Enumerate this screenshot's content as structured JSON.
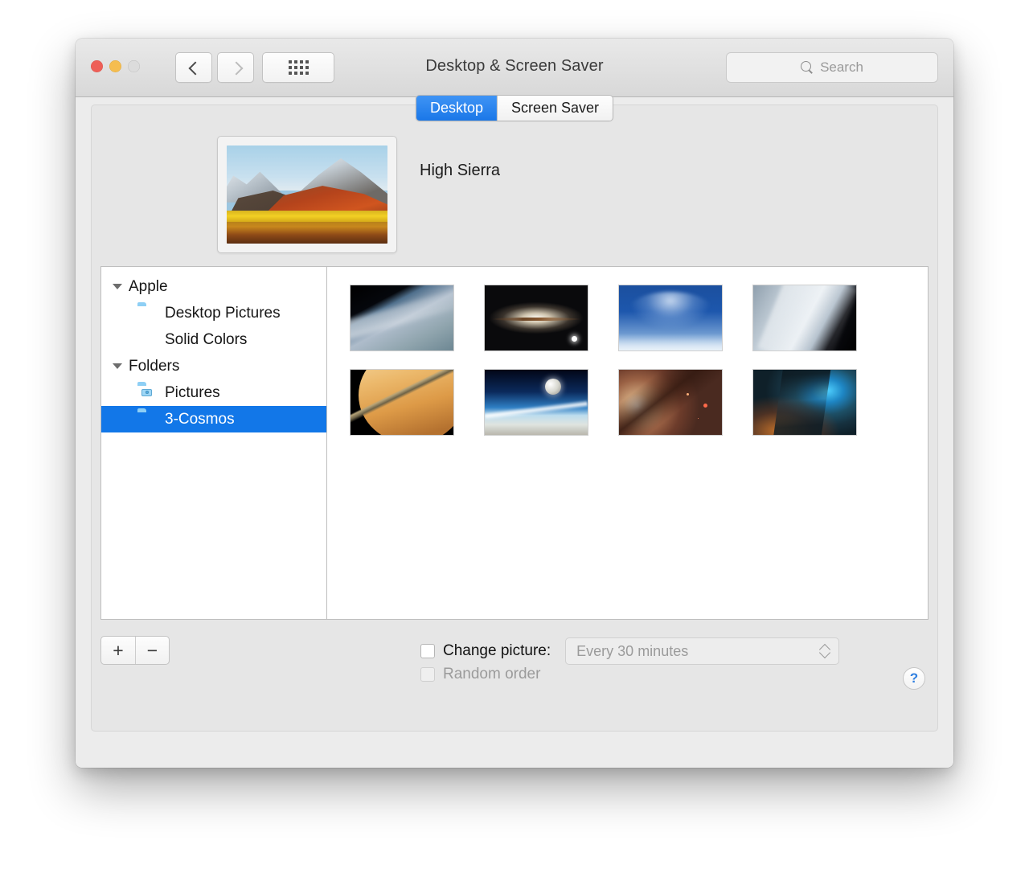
{
  "window": {
    "title": "Desktop & Screen Saver",
    "controls": {
      "close": "close",
      "minimize": "minimize",
      "zoom": "zoom"
    },
    "toolbar": {
      "back_label": "‹",
      "forward_label": "›",
      "show_all_label": "show-all-grid"
    },
    "search": {
      "placeholder": "Search",
      "value": "",
      "icon": "search-icon"
    }
  },
  "tabs": [
    {
      "label": "Desktop",
      "active": true
    },
    {
      "label": "Screen Saver",
      "active": false
    }
  ],
  "preview": {
    "wallpaper_name": "High Sierra",
    "thumbnail_alt": "high-sierra-wallpaper"
  },
  "sidebar": {
    "items": [
      {
        "label": "Apple",
        "type": "group",
        "expanded": true,
        "selected": false,
        "icon": "disclosure-triangle"
      },
      {
        "label": "Desktop Pictures",
        "type": "child",
        "selected": false,
        "icon": "folder-icon"
      },
      {
        "label": "Solid Colors",
        "type": "child",
        "selected": false,
        "icon": "color-wheel-icon"
      },
      {
        "label": "Folders",
        "type": "group",
        "expanded": true,
        "selected": false,
        "icon": "disclosure-triangle"
      },
      {
        "label": "Pictures",
        "type": "child",
        "selected": false,
        "icon": "pictures-folder-icon"
      },
      {
        "label": "3-Cosmos",
        "type": "child",
        "selected": true,
        "icon": "folder-icon"
      }
    ]
  },
  "thumbnails": [
    {
      "name": "earth-from-orbit-clouds",
      "style": "t-earth1"
    },
    {
      "name": "sombrero-galaxy",
      "style": "t-sombrero"
    },
    {
      "name": "milky-way-arch",
      "style": "t-milky"
    },
    {
      "name": "earth-limb-clouds",
      "style": "t-earth2"
    },
    {
      "name": "saturn-rings",
      "style": "t-saturn"
    },
    {
      "name": "earth-atmosphere-moon",
      "style": "t-limb"
    },
    {
      "name": "galactic-core",
      "style": "t-core"
    },
    {
      "name": "blue-orange-nebula",
      "style": "t-nebula"
    }
  ],
  "bottom": {
    "add_label": "+",
    "remove_label": "−",
    "change_picture_label": "Change picture:",
    "change_picture_checked": false,
    "interval_value": "Every 30 minutes",
    "interval_enabled": false,
    "random_order_label": "Random order",
    "random_order_checked": false,
    "random_order_enabled": false,
    "help_label": "?"
  },
  "colors": {
    "accent_blue": "#1277e8",
    "tab_active": "#2d86f0",
    "close": "#ee5f57",
    "minimize": "#f5bd4f",
    "zoom_disabled": "#dcdcdc",
    "help_blue": "#2f7fe0"
  }
}
